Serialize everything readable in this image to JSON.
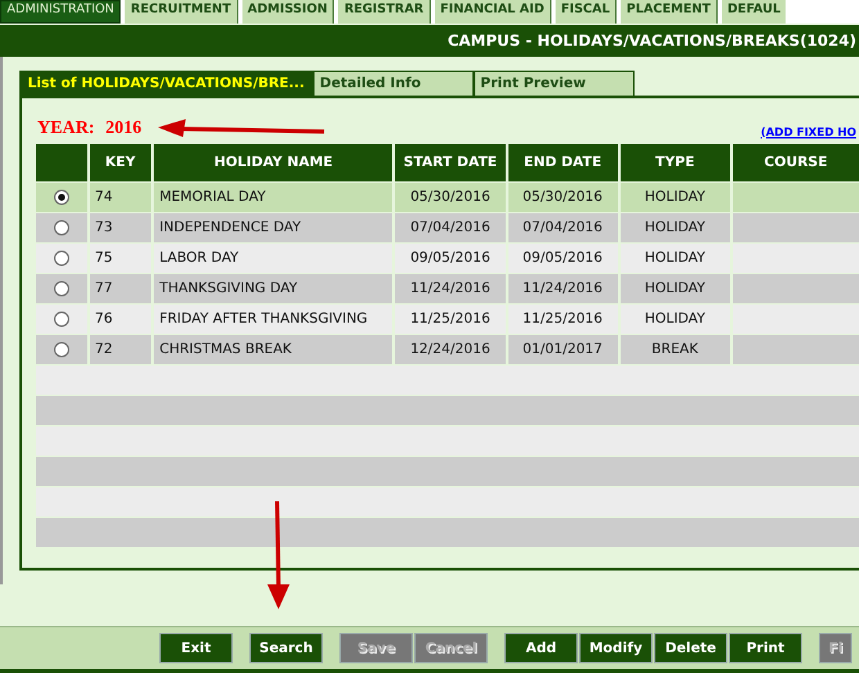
{
  "top_tabs": [
    {
      "label": "ADMINISTRATION",
      "selected": true
    },
    {
      "label": "RECRUITMENT",
      "selected": false
    },
    {
      "label": "ADMISSION",
      "selected": false
    },
    {
      "label": "REGISTRAR",
      "selected": false
    },
    {
      "label": "FINANCIAL AID",
      "selected": false
    },
    {
      "label": "FISCAL",
      "selected": false
    },
    {
      "label": "PLACEMENT",
      "selected": false
    },
    {
      "label": "DEFAUL",
      "selected": false
    }
  ],
  "title": "CAMPUS - HOLIDAYS/VACATIONS/BREAKS(1024)",
  "tabs": [
    {
      "label": "List of HOLIDAYS/VACATIONS/BRE...",
      "selected": true
    },
    {
      "label": "Detailed Info",
      "selected": false
    },
    {
      "label": "Print Preview",
      "selected": false
    }
  ],
  "year": {
    "label": "YEAR:",
    "value": "2016"
  },
  "add_link": "(ADD FIXED HO",
  "table": {
    "columns": [
      "KEY",
      "HOLIDAY NAME",
      "START DATE",
      "END DATE",
      "TYPE",
      "COURSE"
    ],
    "rows": [
      {
        "selected": true,
        "cells": [
          "74",
          "MEMORIAL DAY",
          "05/30/2016",
          "05/30/2016",
          "HOLIDAY"
        ]
      },
      {
        "selected": false,
        "cells": [
          "73",
          "INDEPENDENCE DAY",
          "07/04/2016",
          "07/04/2016",
          "HOLIDAY"
        ]
      },
      {
        "selected": false,
        "cells": [
          "75",
          "LABOR DAY",
          "09/05/2016",
          "09/05/2016",
          "HOLIDAY"
        ]
      },
      {
        "selected": false,
        "cells": [
          "77",
          "THANKSGIVING DAY",
          "11/24/2016",
          "11/24/2016",
          "HOLIDAY"
        ]
      },
      {
        "selected": false,
        "cells": [
          "76",
          "FRIDAY AFTER THANKSGIVING",
          "11/25/2016",
          "11/25/2016",
          "HOLIDAY"
        ]
      },
      {
        "selected": false,
        "cells": [
          "72",
          "CHRISTMAS BREAK",
          "12/24/2016",
          "01/01/2017",
          "BREAK"
        ]
      }
    ]
  },
  "button_groups": [
    [
      {
        "label": "Exit",
        "disabled": false
      }
    ],
    [
      {
        "label": "Search",
        "disabled": false
      }
    ],
    [
      {
        "label": "Save",
        "disabled": true
      },
      {
        "label": "Cancel",
        "disabled": true
      }
    ],
    [
      {
        "label": "Add",
        "disabled": false
      },
      {
        "label": "Modify",
        "disabled": false
      },
      {
        "label": "Delete",
        "disabled": false
      },
      {
        "label": "Print",
        "disabled": false
      }
    ],
    [
      {
        "label": "Fi",
        "disabled": true
      }
    ]
  ]
}
